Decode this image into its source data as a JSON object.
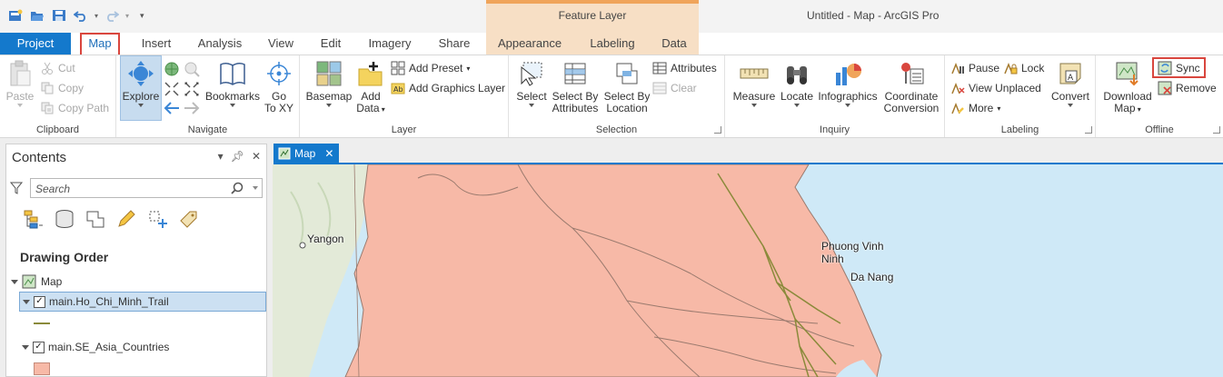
{
  "window": {
    "title": "Untitled - Map - ArcGIS Pro"
  },
  "context_tab_group": {
    "title": "Feature Layer"
  },
  "tabs": {
    "project": "Project",
    "map": "Map",
    "insert": "Insert",
    "analysis": "Analysis",
    "view": "View",
    "edit": "Edit",
    "imagery": "Imagery",
    "share": "Share",
    "appearance": "Appearance",
    "labeling": "Labeling",
    "data": "Data"
  },
  "ribbon": {
    "clipboard": {
      "label": "Clipboard",
      "paste": "Paste",
      "cut": "Cut",
      "copy": "Copy",
      "copy_path": "Copy Path"
    },
    "navigate": {
      "label": "Navigate",
      "explore": "Explore",
      "bookmarks": "Bookmarks",
      "go_to_xy_line1": "Go",
      "go_to_xy_line2": "To XY"
    },
    "layer": {
      "label": "Layer",
      "basemap": "Basemap",
      "add_data_line1": "Add",
      "add_data_line2": "Data",
      "add_preset": "Add Preset",
      "add_graphics_layer": "Add Graphics Layer"
    },
    "selection": {
      "label": "Selection",
      "select": "Select",
      "select_by_attributes_1": "Select By",
      "select_by_attributes_2": "Attributes",
      "select_by_location_1": "Select By",
      "select_by_location_2": "Location",
      "attributes": "Attributes",
      "clear": "Clear"
    },
    "inquiry": {
      "label": "Inquiry",
      "measure": "Measure",
      "locate": "Locate",
      "infographics": "Infographics",
      "coord_conv_1": "Coordinate",
      "coord_conv_2": "Conversion"
    },
    "labeling": {
      "label": "Labeling",
      "pause": "Pause",
      "lock": "Lock",
      "view_unplaced": "View Unplaced",
      "more": "More",
      "convert": "Convert"
    },
    "offline": {
      "label": "Offline",
      "download_map_1": "Download",
      "download_map_2": "Map",
      "sync": "Sync",
      "remove": "Remove"
    }
  },
  "contents": {
    "title": "Contents",
    "search_placeholder": "Search",
    "drawing_order": "Drawing Order",
    "map_node": "Map",
    "layers": [
      "main.Ho_Chi_Minh_Trail",
      "main.SE_Asia_Countries"
    ]
  },
  "map_view": {
    "tab_label": "Map",
    "labels": [
      "Yangon",
      "Phuong Vinh",
      "Ninh",
      "Da Nang"
    ]
  },
  "colors": {
    "accent": "#1479cc",
    "highlight_outline": "#d9463e",
    "country_fill": "#f7b9a7",
    "trail_line": "#8a8a3a",
    "water": "#cfe9f7"
  }
}
